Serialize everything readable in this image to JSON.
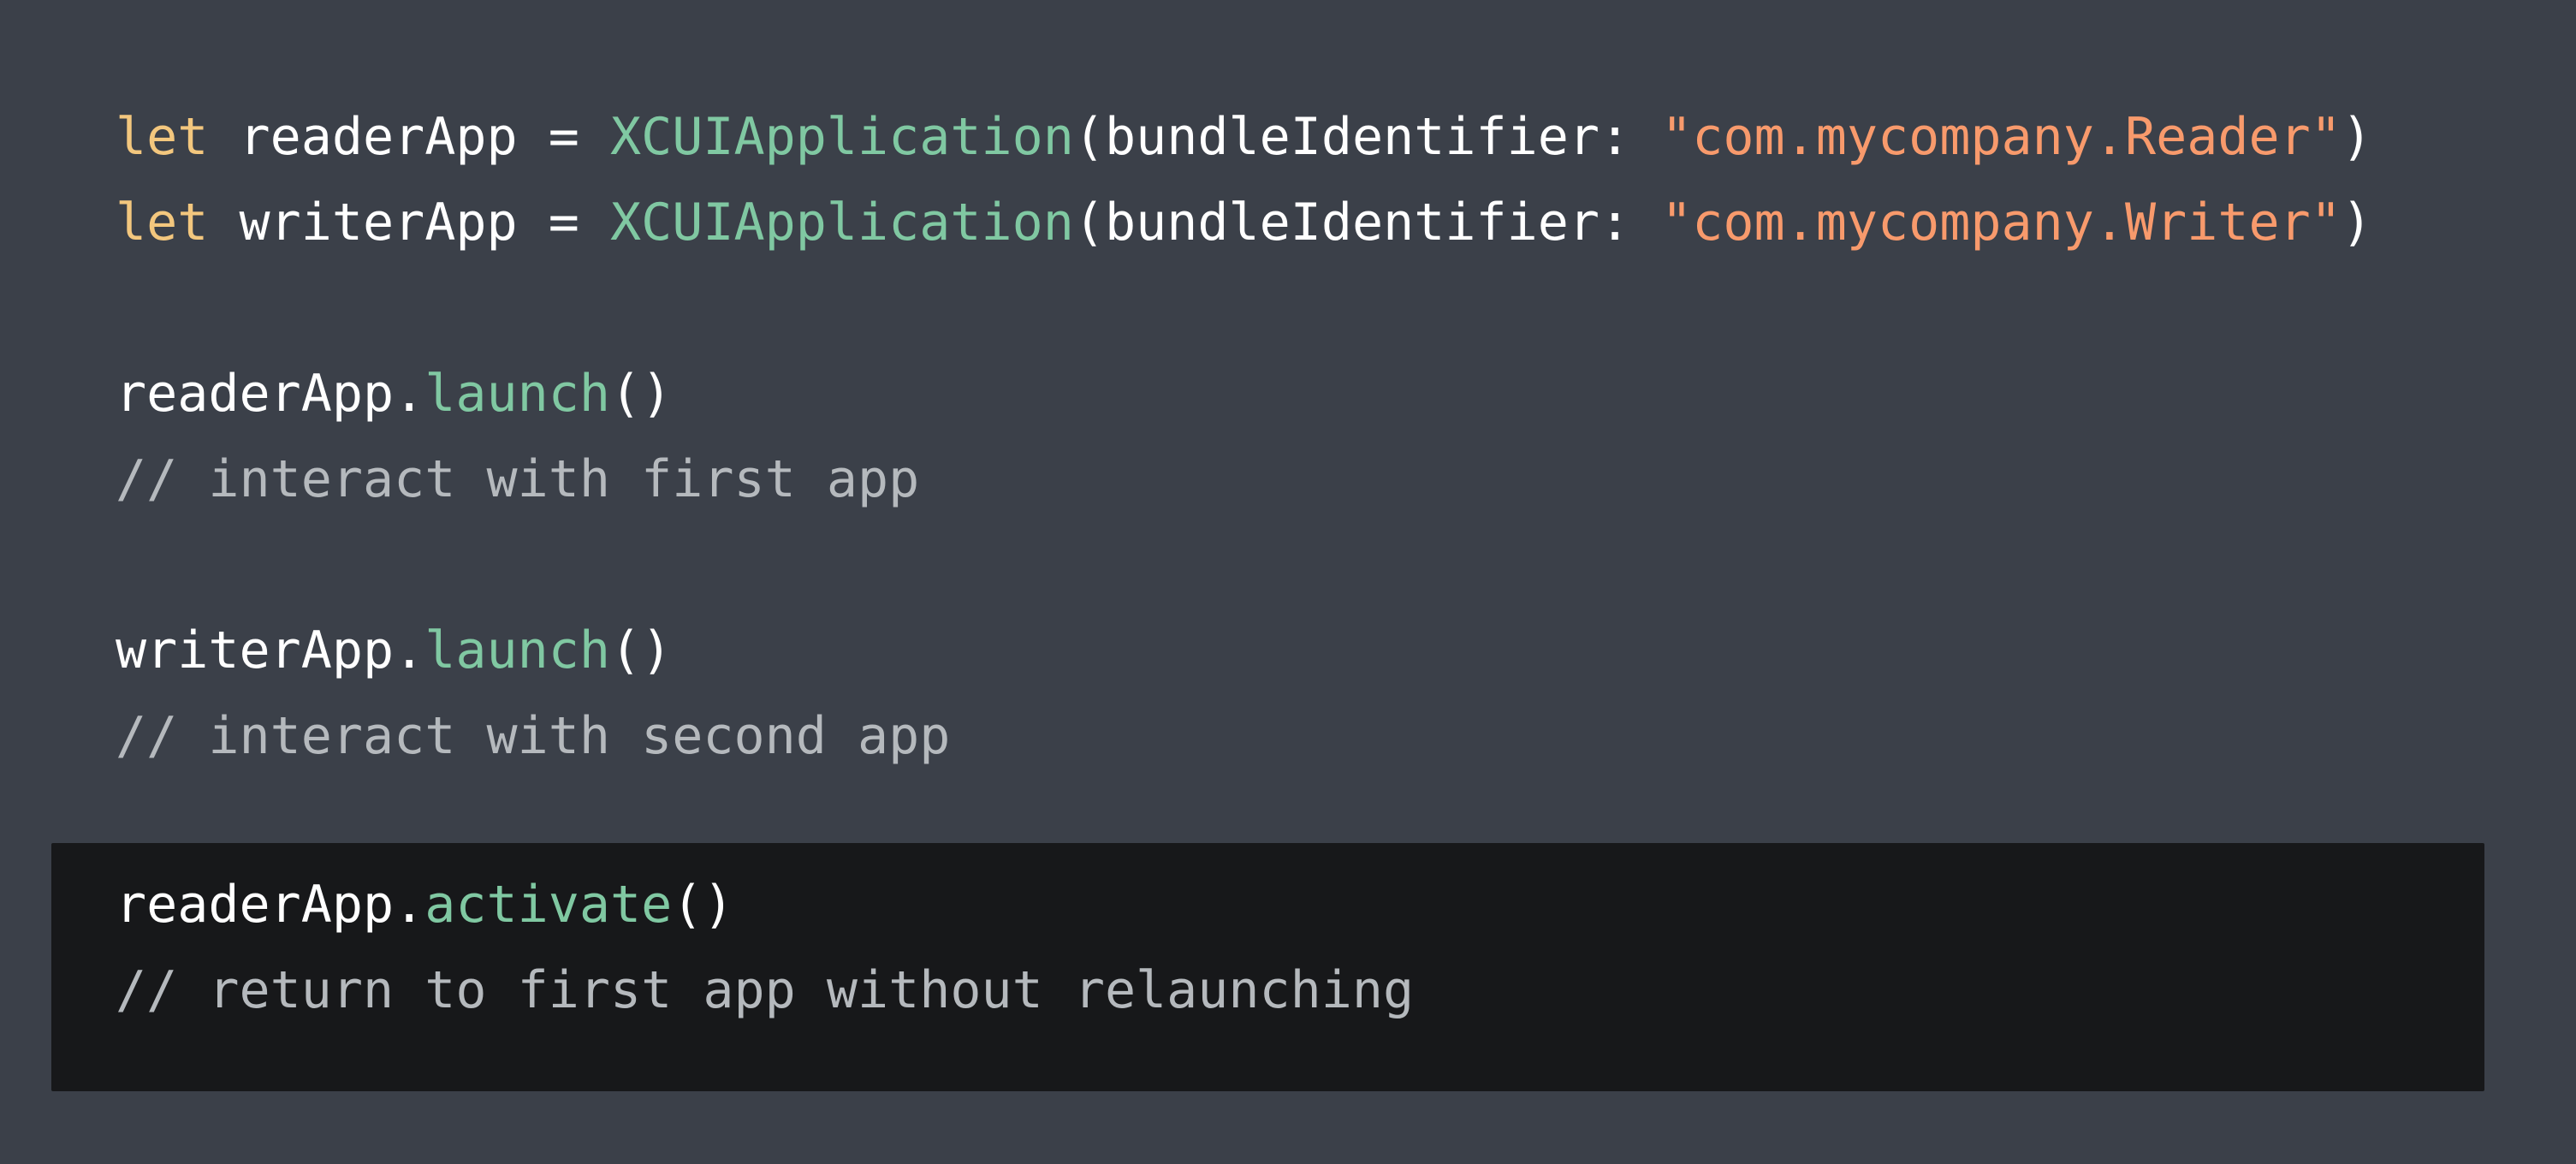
{
  "editor": {
    "language": "Swift",
    "background_color": "#3b4049",
    "highlight_background_color": "#17181a",
    "colors": {
      "keyword": "#f3c77e",
      "type": "#80c8a2",
      "function": "#80c8a2",
      "string": "#f89a6c",
      "plain": "#ffffff",
      "comment": "#b5b9bd"
    }
  },
  "lines": {
    "line1": {
      "keyword": "let ",
      "variable": "readerApp ",
      "equals": "= ",
      "type": "XCUIApplication",
      "open_paren": "(",
      "label": "bundleIdentifier: ",
      "string": "\"com.mycompany.Reader\"",
      "close_paren": ")"
    },
    "line2": {
      "keyword": "let ",
      "variable": "writerApp ",
      "equals": "= ",
      "type": "XCUIApplication",
      "open_paren": "(",
      "label": "bundleIdentifier: ",
      "string": "\"com.mycompany.Writer\"",
      "close_paren": ")"
    },
    "line4": {
      "receiver": "readerApp.",
      "method": "launch",
      "parens": "()"
    },
    "line5": {
      "comment": "// interact with first app"
    },
    "line7": {
      "receiver": "writerApp.",
      "method": "launch",
      "parens": "()"
    },
    "line8": {
      "comment": "// interact with second app"
    },
    "line10": {
      "receiver": "readerApp.",
      "method": "activate",
      "parens": "()"
    },
    "line11": {
      "comment": "// return to first app without relaunching"
    }
  }
}
